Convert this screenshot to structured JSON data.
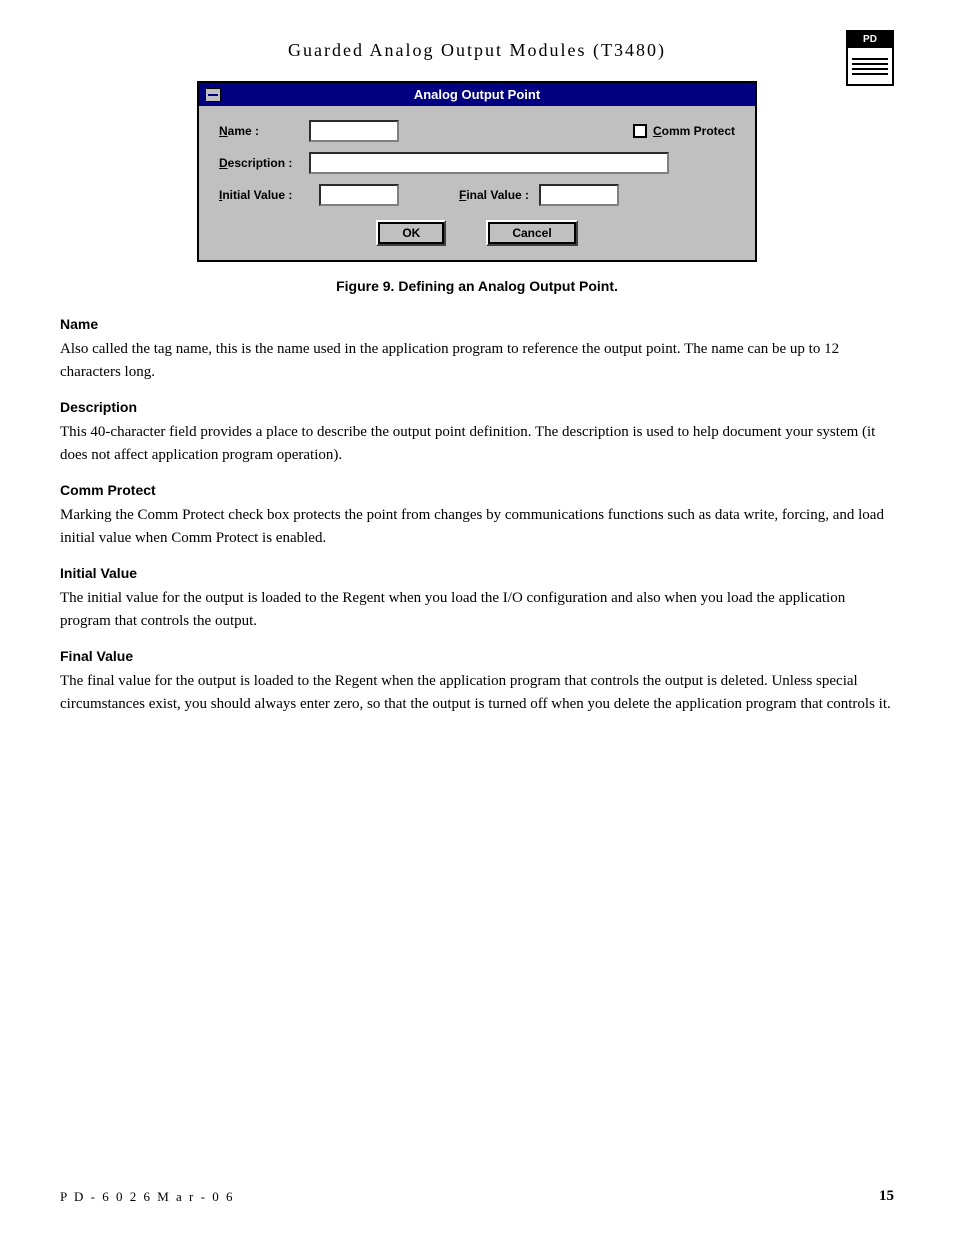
{
  "header": {
    "title": "Guarded   Analog   Output   Modules (T3480)",
    "icon_label": "PD"
  },
  "dialog": {
    "title": "Analog Output Point",
    "name_label": "Name :",
    "name_underline": "N",
    "description_label": "Description :",
    "description_underline": "D",
    "initial_value_label": "Initial Value :",
    "initial_value_underline": "I",
    "final_value_label": "Final Value :",
    "final_value_underline": "F",
    "comm_protect_label": "Comm Protect",
    "comm_protect_underline": "C",
    "ok_button": "OK",
    "cancel_button": "Cancel"
  },
  "figure_caption": "Figure 9.  Defining an Analog Output Point.",
  "sections": [
    {
      "id": "name",
      "heading": "Name",
      "body": "Also called the tag name, this is the name used in the application program to reference the output point.  The name can be up to 12 characters long."
    },
    {
      "id": "description",
      "heading": "Description",
      "body": "This 40-character field provides a place to describe the output point definition.  The description is used to help document your system (it does not affect application program operation)."
    },
    {
      "id": "comm-protect",
      "heading": "Comm Protect",
      "body": "Marking the Comm Protect check box protects the point from changes by communications functions such as data write, forcing, and load initial value when Comm Protect is enabled."
    },
    {
      "id": "initial-value",
      "heading": "Initial Value",
      "body": "The initial value for the output is loaded to the Regent when you load the I/O configuration and also when you load the application program that controls the output."
    },
    {
      "id": "final-value",
      "heading": "Final Value",
      "body": "The final value for the output is loaded to the Regent when the application program that controls the output is deleted. Unless special circumstances exist, you should always enter zero, so that the output is turned off when you delete the application program that controls it."
    }
  ],
  "footer": {
    "left": "P D - 6 0 2 6     M a r - 0 6",
    "page": "15"
  }
}
